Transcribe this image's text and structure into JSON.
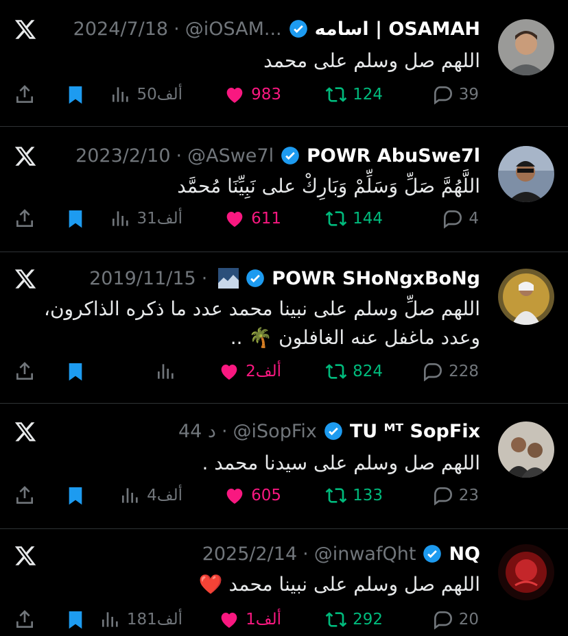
{
  "colors": {
    "bg": "#000000",
    "text": "#e7e9ea",
    "muted": "#71767b",
    "like": "#f91880",
    "retweet": "#00ba7c",
    "bookmark": "#1d9bf0",
    "verified": "#1d9bf0"
  },
  "tweets": [
    {
      "name": "اسامه | OSAMAH",
      "handle": "@iOSAM...",
      "date": "2024/7/18",
      "text": "اللهم صل وسلم على محمد",
      "views": "50ألف",
      "likes": "983",
      "retweets": "124",
      "replies": "39",
      "bookmarked": true,
      "liked": true
    },
    {
      "name": "POWR AbuSwe7l",
      "handle": "@ASwe7l",
      "date": "2023/2/10",
      "text": "اللَّهُمَّ صَلِّ وَسَلِّمْ وَبَارِكْ على نَبِيِّنَا مُحمَّد",
      "views": "31ألف",
      "likes": "611",
      "retweets": "144",
      "replies": "4",
      "bookmarked": true,
      "liked": true
    },
    {
      "name": "POWR SHoNgxBoNg",
      "handle": "",
      "date": "2019/11/15",
      "text": "اللهم صلِّ وسلم على نبينا محمد عدد ما ذكره الذاكرون، وعدد ماغفل عنه الغافلون 🌴 ..",
      "views": "",
      "likes": "2ألف",
      "retweets": "824",
      "replies": "228",
      "bookmarked": true,
      "liked": true
    },
    {
      "name": "TU ᴹᵀ SopFix",
      "handle": "@iSopFix",
      "date": "44 د",
      "text": "اللهم صل وسلم على سيدنا محمد .",
      "views": "4ألف",
      "likes": "605",
      "retweets": "133",
      "replies": "23",
      "bookmarked": true,
      "liked": true
    },
    {
      "name": "NQ",
      "handle": "@inwafQht",
      "date": "2025/2/14",
      "text": "اللهم صل وسلم على نبينا محمد ❤️",
      "views": "181ألف",
      "likes": "1ألف",
      "retweets": "292",
      "replies": "20",
      "bookmarked": true,
      "liked": true
    }
  ]
}
